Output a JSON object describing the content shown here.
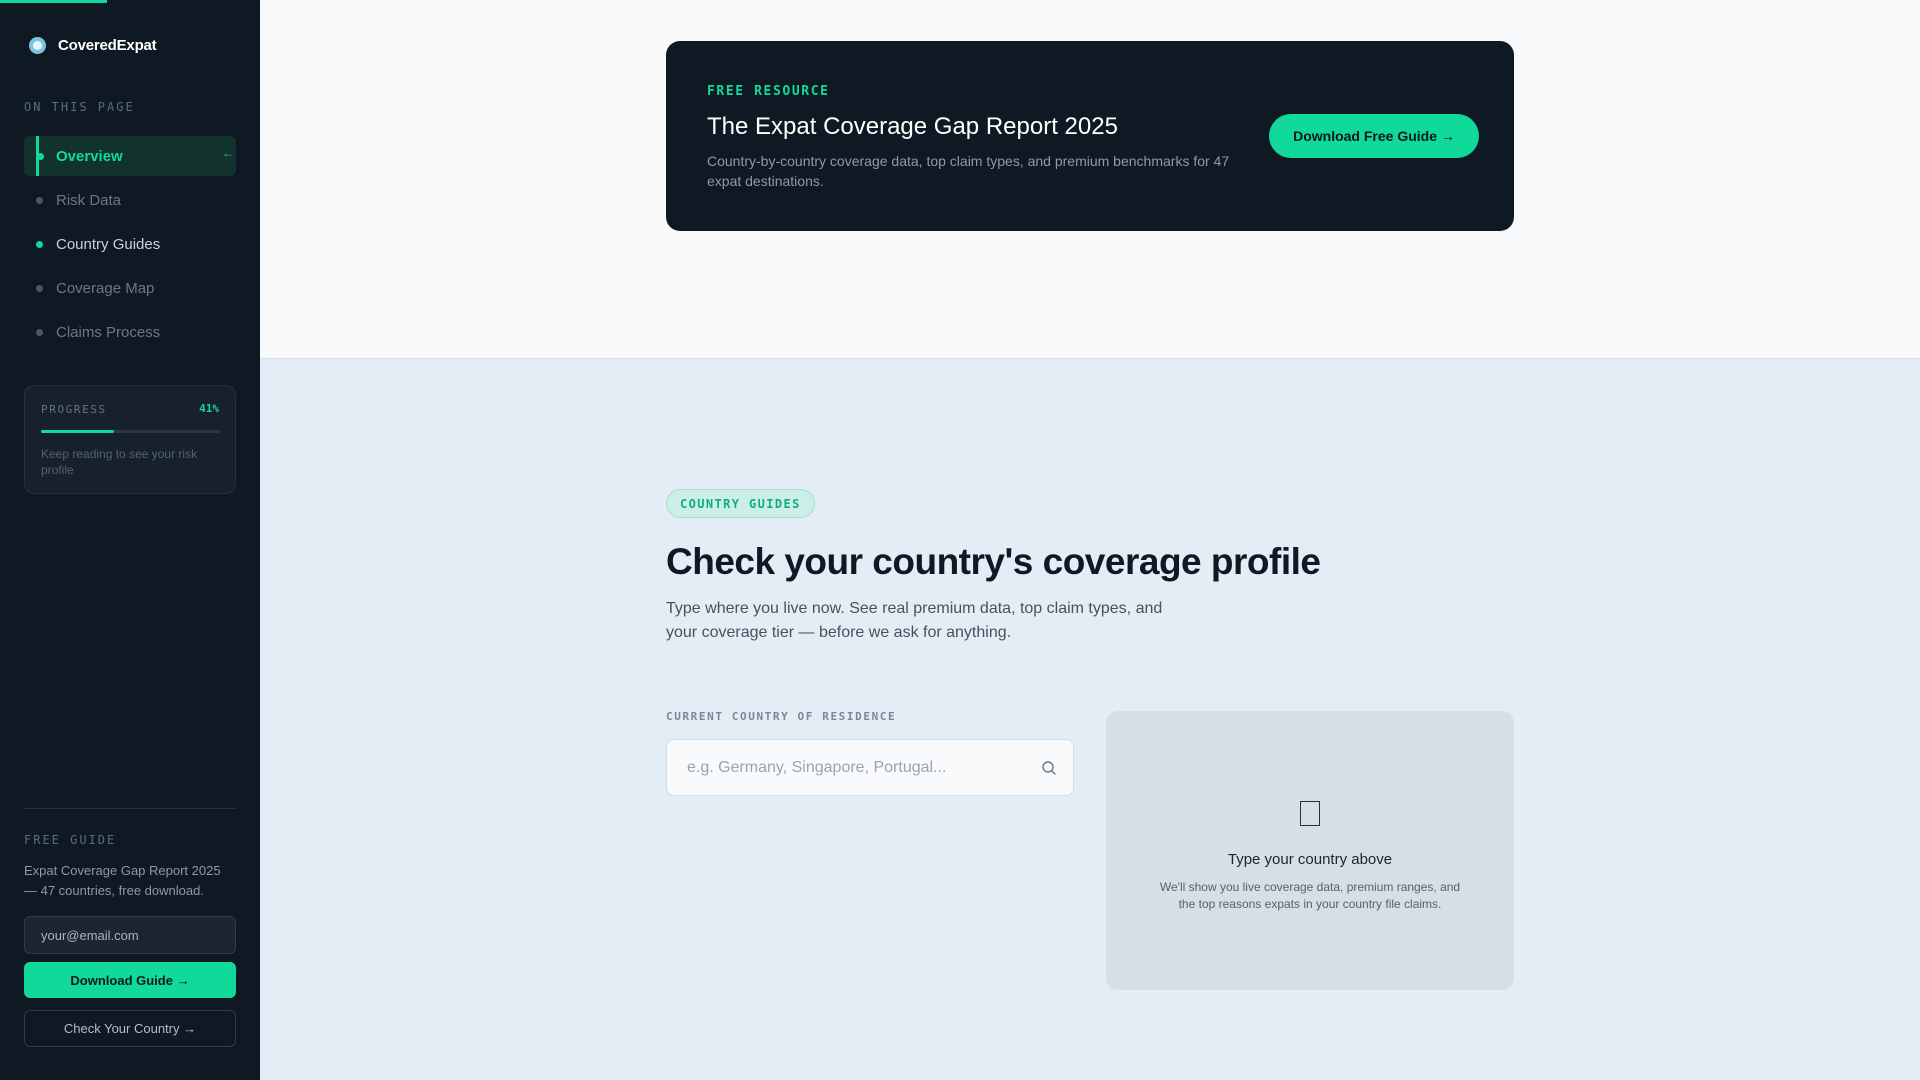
{
  "brand": {
    "name": "CoveredExpat"
  },
  "sidebar": {
    "heading": "ON THIS PAGE",
    "items": [
      {
        "label": "Overview",
        "state": "active"
      },
      {
        "label": "Risk Data",
        "state": "default"
      },
      {
        "label": "Country Guides",
        "state": "visited"
      },
      {
        "label": "Coverage Map",
        "state": "default"
      },
      {
        "label": "Claims Process",
        "state": "default"
      }
    ],
    "progress": {
      "label": "PROGRESS",
      "value_text": "41%",
      "value": 0.41,
      "note": "Keep reading to see your risk profile"
    },
    "guide": {
      "heading": "FREE GUIDE",
      "text": "Expat Coverage Gap Report 2025 — 47 countries, free download.",
      "email_placeholder": "your@email.com",
      "download_label": "Download Guide →",
      "check_label": "Check Your Country →"
    }
  },
  "banner": {
    "eyebrow": "FREE RESOURCE",
    "title": "The Expat Coverage Gap Report 2025",
    "description": "Country-by-country coverage data, top claim types, and premium benchmarks for 47 expat destinations.",
    "button_label": "Download Free Guide →"
  },
  "country_section": {
    "pill": "COUNTRY GUIDES",
    "title": "Check your country's coverage profile",
    "description": "Type where you live now. See real premium data, top claim types, and your coverage tier — before we ask for anything.",
    "field_label": "CURRENT COUNTRY OF RESIDENCE",
    "search_placeholder": "e.g. Germany, Singapore, Portugal...",
    "empty_state": {
      "title": "Type your country above",
      "description": "We'll show you live coverage data, premium ranges, and the top reasons expats in your country file claims."
    }
  },
  "colors": {
    "accent": "#10d99a",
    "sidebar_bg": "#0f1923",
    "section_bg": "#e4edf6"
  },
  "icons": [
    "brand-logo-icon",
    "search-icon",
    "document-icon",
    "arrow-right-icon"
  ]
}
